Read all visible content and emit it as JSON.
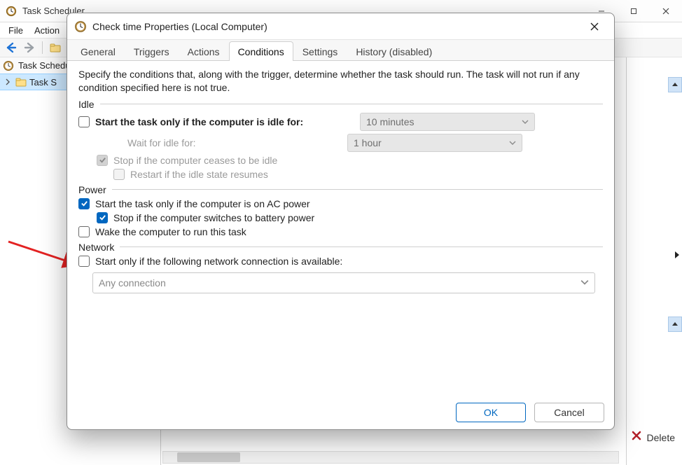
{
  "main_window": {
    "title": "Task Scheduler",
    "menus": [
      "File",
      "Action"
    ],
    "tree_root": "Task Scheduler",
    "tree_child": "Task S",
    "delete_label": "Delete"
  },
  "dialog": {
    "title": "Check time Properties (Local Computer)",
    "tabs": [
      "General",
      "Triggers",
      "Actions",
      "Conditions",
      "Settings",
      "History (disabled)"
    ],
    "active_tab_index": 3,
    "description": "Specify the conditions that, along with the trigger, determine whether the task should run.  The task will not run  if any condition specified here is not true.",
    "sections": {
      "idle": {
        "heading": "Idle",
        "start_if_idle": {
          "checked": false,
          "label": "Start the task only if the computer is idle for:"
        },
        "idle_duration": "10 minutes",
        "wait_label": "Wait for idle for:",
        "wait_duration": "1 hour",
        "stop_if_not_idle": {
          "checked": true,
          "disabled": true,
          "label": "Stop if the computer ceases to be idle"
        },
        "restart_if_idle": {
          "checked": false,
          "disabled": true,
          "label": "Restart if the idle state resumes"
        }
      },
      "power": {
        "heading": "Power",
        "ac_only": {
          "checked": true,
          "label": "Start the task only if the computer is on AC power"
        },
        "stop_on_battery": {
          "checked": true,
          "label": "Stop if the computer switches to battery power"
        },
        "wake": {
          "checked": false,
          "label": "Wake the computer to run this task"
        }
      },
      "network": {
        "heading": "Network",
        "only_if_network": {
          "checked": false,
          "label": "Start only if the following network connection is available:"
        },
        "connection": "Any connection"
      }
    },
    "buttons": {
      "ok": "OK",
      "cancel": "Cancel"
    }
  }
}
